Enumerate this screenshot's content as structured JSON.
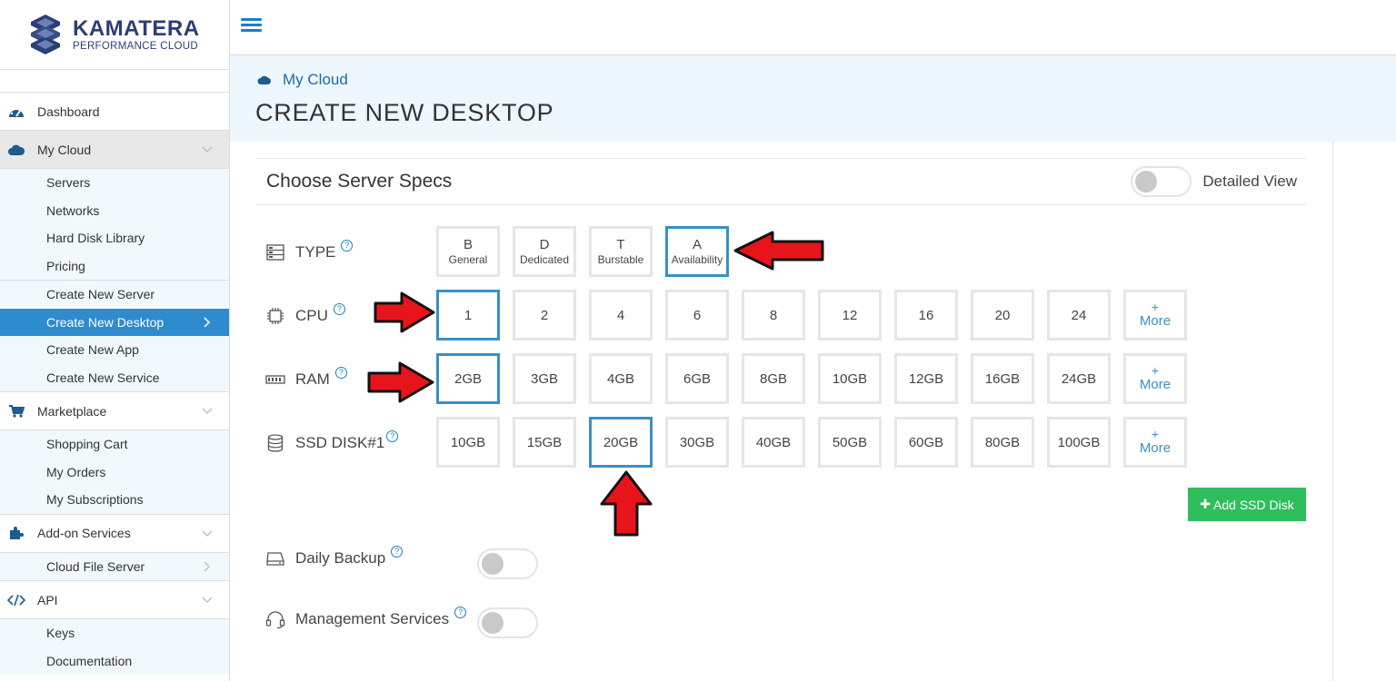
{
  "brand": {
    "name": "KAMATERA",
    "tagline": "PERFORMANCE CLOUD"
  },
  "sidebar": {
    "dashboard": "Dashboard",
    "my_cloud": "My Cloud",
    "my_cloud_items": [
      "Servers",
      "Networks",
      "Hard Disk Library",
      "Pricing"
    ],
    "create_items": [
      "Create New Server",
      "Create New Desktop",
      "Create New App",
      "Create New Service"
    ],
    "marketplace": "Marketplace",
    "marketplace_items": [
      "Shopping Cart",
      "My Orders",
      "My Subscriptions"
    ],
    "addon": "Add-on Services",
    "addon_items": [
      "Cloud File Server"
    ],
    "api": "API",
    "api_items": [
      "Keys",
      "Documentation"
    ]
  },
  "header": {
    "breadcrumb": "My Cloud",
    "title": "CREATE NEW DESKTOP"
  },
  "panel": {
    "title": "Choose Server Specs",
    "detailed_view_label": "Detailed View",
    "help_glyph": "?",
    "type": {
      "label": "TYPE",
      "options": [
        {
          "main": "B",
          "sub": "General"
        },
        {
          "main": "D",
          "sub": "Dedicated"
        },
        {
          "main": "T",
          "sub": "Burstable"
        },
        {
          "main": "A",
          "sub": "Availability"
        }
      ],
      "selected_index": 3
    },
    "cpu": {
      "label": "CPU",
      "options": [
        "1",
        "2",
        "4",
        "6",
        "8",
        "12",
        "16",
        "20",
        "24"
      ],
      "selected_index": 0
    },
    "ram": {
      "label": "RAM",
      "options": [
        "2GB",
        "3GB",
        "4GB",
        "6GB",
        "8GB",
        "10GB",
        "12GB",
        "16GB",
        "24GB"
      ],
      "selected_index": 0
    },
    "ssd": {
      "label": "SSD DISK#1",
      "options": [
        "10GB",
        "15GB",
        "20GB",
        "30GB",
        "40GB",
        "50GB",
        "60GB",
        "80GB",
        "100GB"
      ],
      "selected_index": 2
    },
    "more": {
      "plus": "+",
      "label": "More"
    },
    "add_ssd": "Add SSD Disk",
    "add_ssd_plus": "✚",
    "daily_backup": "Daily Backup",
    "management_services": "Management Services"
  },
  "colors": {
    "accent": "#2e8bce",
    "brand": "#2d3e75",
    "success": "#2fbe5d",
    "arrow": "#e8141b"
  }
}
